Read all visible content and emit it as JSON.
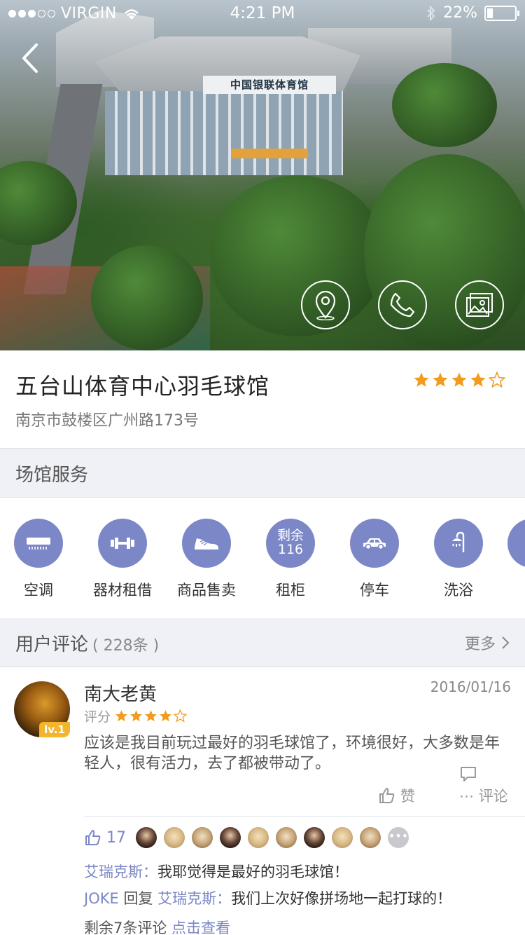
{
  "status_bar": {
    "carrier": "VIRGIN",
    "time": "4:21 PM",
    "battery": "22%",
    "battery_level": 0.22,
    "signal_bars": 3
  },
  "hero": {
    "sign_text": "中国银联体育馆",
    "actions": [
      {
        "name": "location-button",
        "icon": "location-pin-icon"
      },
      {
        "name": "call-button",
        "icon": "phone-icon"
      },
      {
        "name": "photos-button",
        "icon": "gallery-icon"
      }
    ]
  },
  "venue": {
    "title": "五台山体育中心羽毛球馆",
    "address": "南京市鼓楼区广州路173号",
    "rating": 4,
    "rating_max": 5
  },
  "services_section": {
    "label": "场馆服务",
    "items": [
      {
        "label": "空调",
        "icon": "air-conditioner-icon"
      },
      {
        "label": "器材租借",
        "icon": "dumbbell-icon"
      },
      {
        "label": "商品售卖",
        "icon": "sneaker-icon"
      },
      {
        "label": "租柜",
        "icon_text_1": "剩余",
        "icon_text_2": "116"
      },
      {
        "label": "停车",
        "icon": "car-icon"
      },
      {
        "label": "洗浴",
        "icon": "shower-icon"
      }
    ]
  },
  "reviews_section": {
    "label": "用户评论",
    "count": "( 228条 )",
    "more": "更多"
  },
  "review": {
    "user": "南大老黄",
    "level": "lv.1",
    "date": "2016/01/16",
    "score_label": "评分",
    "score": 4,
    "text": "应该是我目前玩过最好的羽毛球馆了，环境很好，大多数是年轻人，很有活力，去了都被带动了。",
    "like_label": "赞",
    "comment_label": "评论",
    "like_count": "17",
    "comments": [
      {
        "user": "艾瑞克斯：",
        "text": "我耶觉得是最好的羽毛球馆！"
      },
      {
        "user": "JOKE",
        "reply": " 回复 ",
        "reply_to": "艾瑞克斯：",
        "text": "我们上次好像拼场地一起打球的！"
      }
    ],
    "remaining_text": "剩余7条评论 ",
    "remaining_link": "点击查看"
  }
}
